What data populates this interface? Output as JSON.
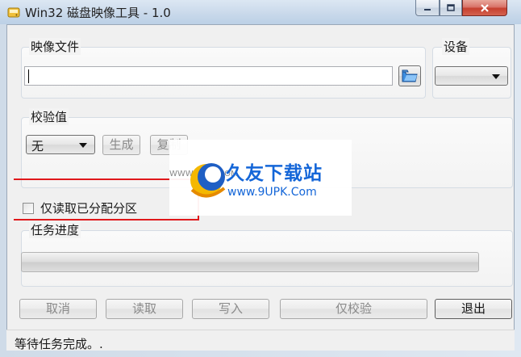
{
  "window": {
    "title": "Win32 磁盘映像工具 - 1.0",
    "caption_buttons": {
      "minimize": "–",
      "maximize": "□",
      "close": "✕"
    }
  },
  "image_file_group": {
    "label": "映像文件",
    "path_value": "",
    "browse_icon": "folder-icon"
  },
  "device_group": {
    "label": "设备",
    "selected": ""
  },
  "checksum_group": {
    "label": "校验值",
    "type_selected": "无",
    "generate_button": "生成",
    "copy_button": "复制"
  },
  "read_only_allocated": {
    "label": "仅读取已分配分区",
    "checked": false
  },
  "progress_group": {
    "label": "任务进度",
    "progress": 0
  },
  "buttons": {
    "cancel": "取消",
    "read": "读取",
    "write": "写入",
    "verify_only": "仅校验",
    "exit": "退出"
  },
  "status_bar": {
    "text": "等待任务完成。."
  },
  "watermark": {
    "title": "久友下载站",
    "url": "www.9UPK.Com",
    "small_url": "WWW.9UPK.COM"
  },
  "colors": {
    "accent_blue": "#1466d8",
    "highlight_red": "#e0181b"
  }
}
